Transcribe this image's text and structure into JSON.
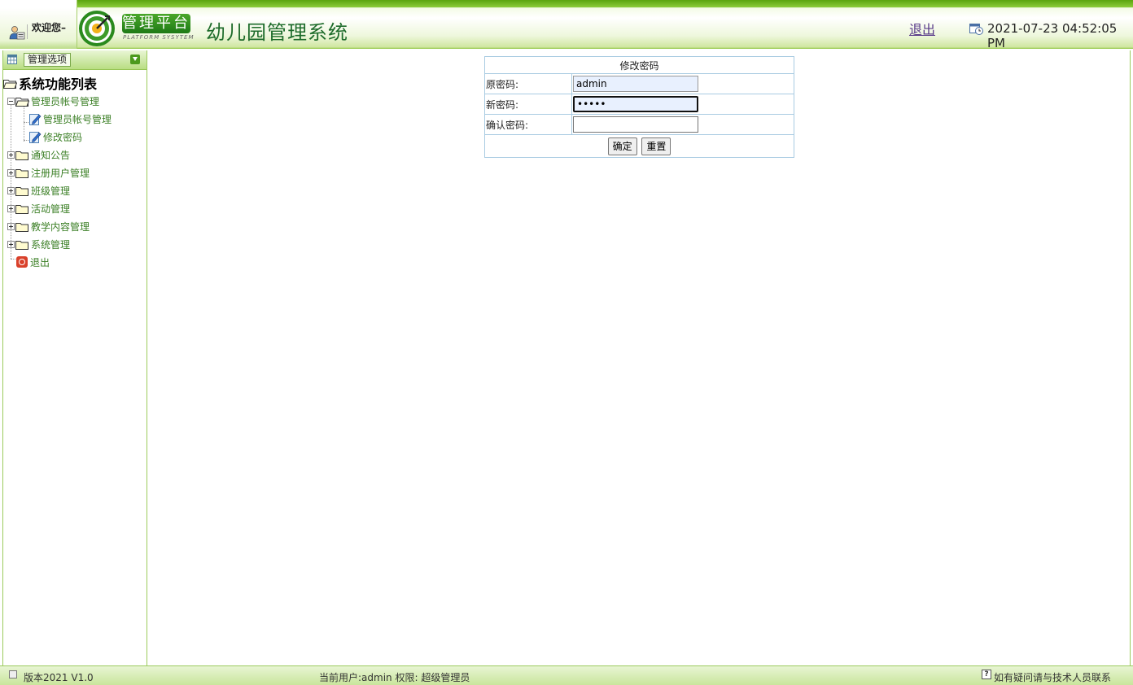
{
  "header": {
    "welcome": "欢迎您–",
    "brand": "管理平台",
    "brand_sub": "PLATFORM SYSYTEM",
    "app_title": "幼儿园管理系统",
    "logout": "退出",
    "datetime": "2021-07-23 04:52:05 PM"
  },
  "sidebar": {
    "options_label": "管理选项",
    "root": "系统功能列表",
    "items": [
      {
        "label": "管理员帐号管理",
        "expanded": true
      },
      {
        "label": "管理员帐号管理"
      },
      {
        "label": "修改密码"
      },
      {
        "label": "通知公告"
      },
      {
        "label": "注册用户管理"
      },
      {
        "label": "班级管理"
      },
      {
        "label": "活动管理"
      },
      {
        "label": "教学内容管理"
      },
      {
        "label": "系统管理"
      },
      {
        "label": "退出"
      }
    ]
  },
  "form": {
    "title": "修改密码",
    "old_label": "原密码:",
    "old_value": "admin",
    "new_label": "新密码:",
    "new_value": "admin",
    "confirm_label": "确认密码:",
    "confirm_value": "",
    "submit": "确定",
    "reset": "重置"
  },
  "footer": {
    "version": "版本2021 V1.0",
    "user_info": "当前用户:admin 权限:   超级管理员",
    "help_glyph": "?",
    "contact": "如有疑问请与技术人员联系"
  },
  "colors": {
    "brand_green": "#1e7a16",
    "tree_text": "#3b7f25",
    "link_purple": "#5a3b8a"
  }
}
